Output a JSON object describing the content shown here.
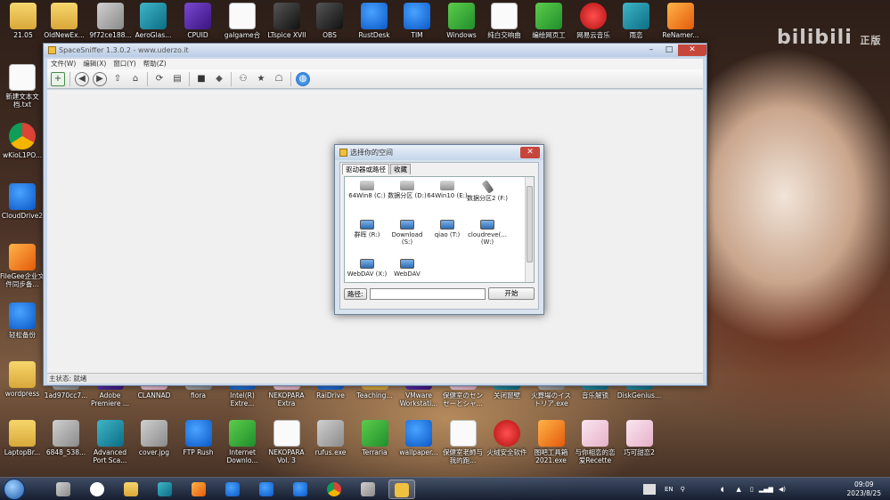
{
  "desktop": {
    "icons_row1": [
      {
        "label": "21.05",
        "icon": "folder-icon"
      },
      {
        "label": "OldNewEx...",
        "icon": "folder-icon"
      },
      {
        "label": "9f72ce188...",
        "icon": "image-icon"
      },
      {
        "label": "AeroGlas...",
        "icon": "app-icon"
      },
      {
        "label": "CPUID",
        "icon": "cpuid-icon"
      },
      {
        "label": "galgame合",
        "icon": "document-icon"
      },
      {
        "label": "LTspice XVII",
        "icon": "ltspice-icon"
      },
      {
        "label": "OBS",
        "icon": "obs-icon"
      },
      {
        "label": "RustDesk",
        "icon": "rustdesk-icon"
      },
      {
        "label": "TIM",
        "icon": "tim-icon"
      },
      {
        "label": "Windows",
        "icon": "windows-icon"
      },
      {
        "label": "纯白交响曲",
        "icon": "music-file-icon"
      },
      {
        "label": "编绘网页工",
        "icon": "cube-icon"
      },
      {
        "label": "网易云音乐",
        "icon": "netease-music-icon"
      },
      {
        "label": "雨恋",
        "icon": "app-icon"
      },
      {
        "label": "ReNamer...",
        "icon": "renamer-icon"
      }
    ],
    "icons_left": [
      {
        "label": "新建文本文档.txt",
        "icon": "text-file-icon"
      },
      {
        "label": "wKioL1PO...",
        "icon": "chrome-icon"
      },
      {
        "label": "CloudDrive2",
        "icon": "cloud-icon"
      },
      {
        "label": "FileGee企业文件同步备...",
        "icon": "filegee-icon"
      },
      {
        "label": "轻松备份",
        "icon": "backup-icon"
      },
      {
        "label": "wordpress",
        "icon": "folder-icon"
      },
      {
        "label": "LaptopBr...",
        "icon": "folder-icon"
      }
    ],
    "icons_row_bottom1": [
      {
        "label": "1ad970cc7...",
        "icon": "image-icon"
      },
      {
        "label": "Adobe Premiere ...",
        "icon": "premiere-icon"
      },
      {
        "label": "CLANNAD",
        "icon": "game-icon"
      },
      {
        "label": "fiora",
        "icon": "image-icon"
      },
      {
        "label": "Intel(R) Extre...",
        "icon": "intel-icon"
      },
      {
        "label": "NEKOPARA Extra",
        "icon": "game-icon"
      },
      {
        "label": "RaiDrive",
        "icon": "raidrive-icon"
      },
      {
        "label": "Teaching...",
        "icon": "folder-icon"
      },
      {
        "label": "VMware Workstati...",
        "icon": "vmware-icon"
      },
      {
        "label": "保健室のセンセーとシャ...",
        "icon": "game-icon"
      },
      {
        "label": "关闭窗壁",
        "icon": "app-icon"
      },
      {
        "label": "火葬場のイストリア.exe",
        "icon": "exe-icon"
      },
      {
        "label": "音乐解锁",
        "icon": "app-icon"
      },
      {
        "label": "DiskGenius...",
        "icon": "diskgenius-icon"
      }
    ],
    "icons_row_bottom2": [
      {
        "label": "6848_538...",
        "icon": "image-icon"
      },
      {
        "label": "Advanced Port Sca...",
        "icon": "port-scanner-icon"
      },
      {
        "label": "cover.jpg",
        "icon": "image-icon"
      },
      {
        "label": "FTP Rush",
        "icon": "ftp-icon"
      },
      {
        "label": "Internet Downlo...",
        "icon": "idm-icon"
      },
      {
        "label": "NEKOPARA Vol. 3",
        "icon": "document-icon"
      },
      {
        "label": "rufus.exe",
        "icon": "rufus-icon"
      },
      {
        "label": "Terraria",
        "icon": "terraria-icon"
      },
      {
        "label": "wallpaper...",
        "icon": "wallpaper-icon"
      },
      {
        "label": "保健室老師与我的跑...",
        "icon": "mp3-file-icon"
      },
      {
        "label": "火绒安全软件",
        "icon": "huorong-icon"
      },
      {
        "label": "图吧工具箱2021.exe",
        "icon": "toolbox-icon"
      },
      {
        "label": "与你相恋的恋爱Recette",
        "icon": "game-icon"
      },
      {
        "label": "巧可甜恋2",
        "icon": "game-icon"
      }
    ]
  },
  "watermark": {
    "main": "bilibili",
    "sub": "正版"
  },
  "main_window": {
    "title": "SpaceSniffer 1.3.0.2 - www.uderzo.it",
    "menu": [
      "文件(W)",
      "编辑(X)",
      "窗口(Y)",
      "帮助(Z)"
    ],
    "status": "主状态: 就绪"
  },
  "dialog": {
    "title": "选择你的空间",
    "tabs": [
      "驱动器或路径",
      "收藏"
    ],
    "drives": [
      {
        "label": "64Win8 (C:)",
        "type": "hdd"
      },
      {
        "label": "数据分区 (D:)",
        "type": "hdd"
      },
      {
        "label": "64Win10 (E:)",
        "type": "hdd"
      },
      {
        "label": "数据分区2 (F:)",
        "type": "usb"
      },
      {
        "label": "群晖 (R:)",
        "type": "net"
      },
      {
        "label": "Download (S:)",
        "type": "net"
      },
      {
        "label": "qiao (T:)",
        "type": "net"
      },
      {
        "label": "cloudreve(... (W:)",
        "type": "net"
      },
      {
        "label": "WebDAV (X:)",
        "type": "net"
      },
      {
        "label": "WebDAV",
        "type": "net"
      }
    ],
    "path_label": "路径:",
    "path_value": "",
    "start_label": "开始"
  },
  "taskbar": {
    "lang": "EN",
    "time": "09:09",
    "date": "2023/8/25"
  }
}
